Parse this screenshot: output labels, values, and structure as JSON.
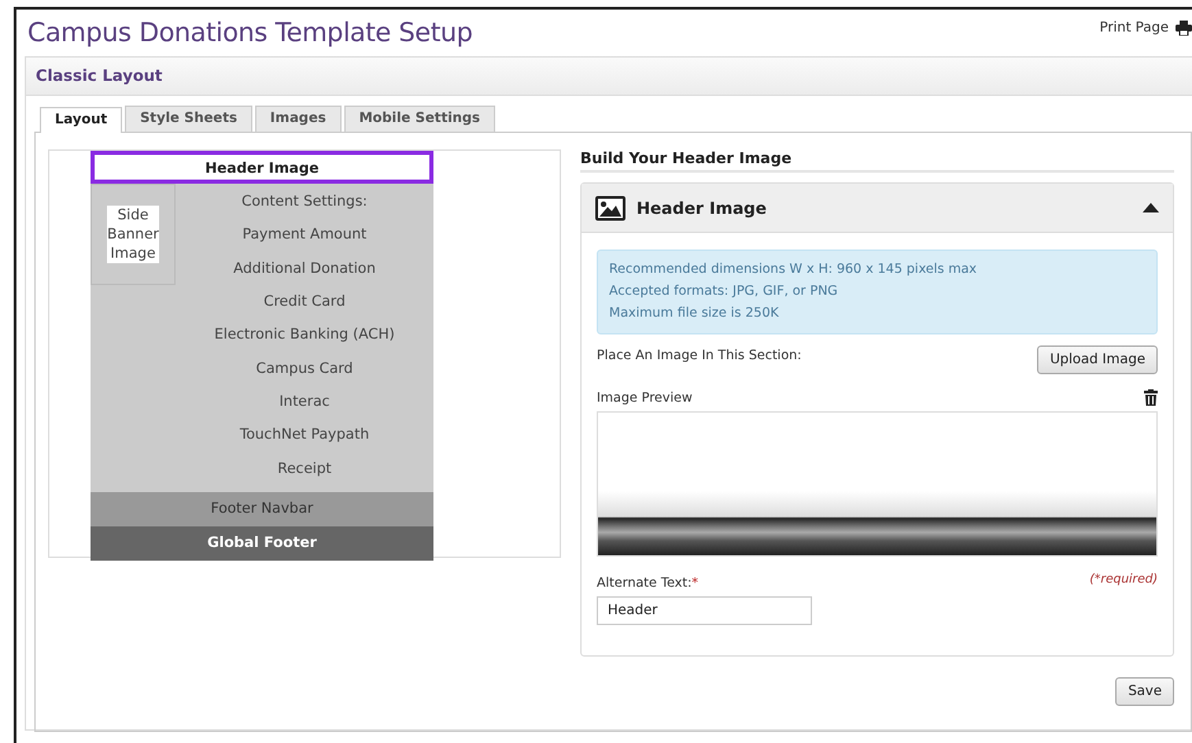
{
  "page": {
    "title": "Campus Donations Template Setup",
    "print_link": "Print Page"
  },
  "panel": {
    "title": "Classic Layout"
  },
  "tabs": [
    {
      "label": "Layout",
      "selected": true
    },
    {
      "label": "Style Sheets",
      "selected": false
    },
    {
      "label": "Images",
      "selected": false
    },
    {
      "label": "Mobile Settings",
      "selected": false
    }
  ],
  "layout_preview": {
    "header_image": {
      "label": "Header Image",
      "selected": true
    },
    "side_banner": {
      "lines": [
        "Side",
        "Banner",
        "Image"
      ],
      "selected": false
    },
    "content_settings": {
      "title": "Content Settings:",
      "items": [
        "Payment Amount",
        "Additional Donation",
        "Credit Card",
        "Electronic Banking (ACH)",
        "Campus Card",
        "Interac",
        "TouchNet Paypath",
        "Receipt"
      ]
    },
    "footer_navbar": {
      "label": "Footer Navbar",
      "selected": false
    },
    "global_footer": {
      "label": "Global Footer",
      "selected": false
    }
  },
  "builder": {
    "heading": "Build Your Header Image",
    "accordion": {
      "title": "Header Image",
      "expanded": true,
      "info_lines": [
        "Recommended dimensions W x H: 960 x 145 pixels max",
        "Accepted formats: JPG, GIF, or PNG",
        "Maximum file size is 250K"
      ],
      "place_label": "Place An Image In This Section:",
      "upload_button": "Upload Image",
      "preview_label": "Image Preview",
      "alt_label": "Alternate Text:",
      "alt_required_mark": "*",
      "required_note": "(*required)",
      "alt_value": "Header"
    },
    "save_button": "Save"
  }
}
